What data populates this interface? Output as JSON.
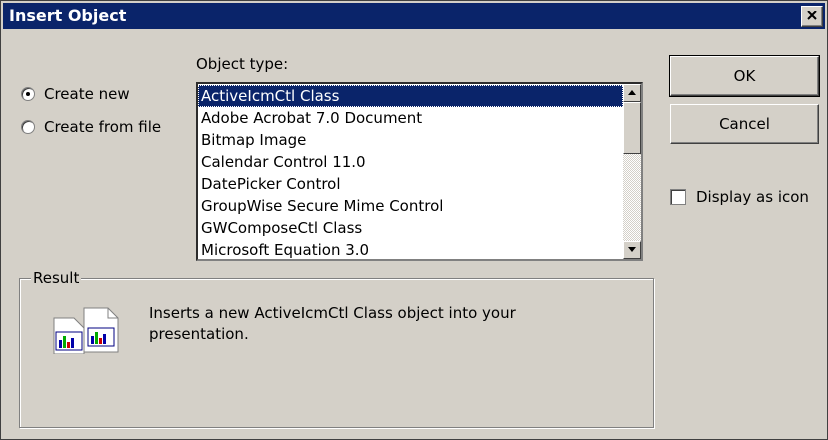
{
  "dialog": {
    "title": "Insert Object"
  },
  "source": {
    "create_new_label": "Create new",
    "create_from_file_label": "Create from file",
    "selected": "Create new"
  },
  "object_type": {
    "label": "Object type:",
    "items": [
      "ActiveIcmCtl Class",
      "Adobe Acrobat 7.0 Document",
      "Bitmap Image",
      "Calendar Control 11.0",
      "DatePicker Control",
      "GroupWise Secure Mime Control",
      "GWComposeCtl Class",
      "Microsoft Equation 3.0"
    ],
    "selected": "ActiveIcmCtl Class"
  },
  "buttons": {
    "ok_label": "OK",
    "cancel_label": "Cancel"
  },
  "display_as_icon": {
    "label": "Display as icon",
    "checked": false
  },
  "result": {
    "label": "Result",
    "text": "Inserts a new ActiveIcmCtl Class object into your presentation."
  },
  "colors": {
    "title_bar": "#0a246a",
    "dialog_face": "#d4d0c8",
    "selection": "#0a246a"
  },
  "icons": [
    "close-icon",
    "scroll-up-icon",
    "scroll-down-icon",
    "object-icon"
  ]
}
